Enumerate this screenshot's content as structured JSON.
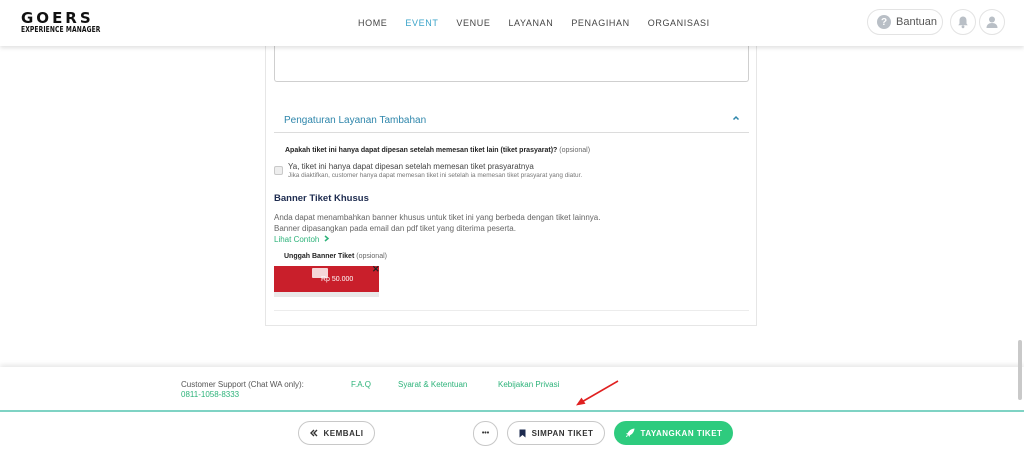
{
  "header": {
    "logo_line1": "GOERS",
    "logo_line2": "EXPERIENCE MANAGER",
    "nav": [
      {
        "label": "HOME",
        "active": false
      },
      {
        "label": "EVENT",
        "active": true
      },
      {
        "label": "VENUE",
        "active": false
      },
      {
        "label": "LAYANAN",
        "active": false
      },
      {
        "label": "PENAGIHAN",
        "active": false
      },
      {
        "label": "ORGANISASI",
        "active": false
      }
    ],
    "help_label": "Bantuan",
    "help_icon": "question-circle-icon",
    "notification_icon": "bell-icon",
    "profile_icon": "user-icon"
  },
  "section": {
    "title": "Pengaturan Layanan Tambahan",
    "question": "Apakah tiket ini hanya dapat dipesan setelah memesan tiket lain (tiket prasyarat)?",
    "question_optional": "(opsional)",
    "checkbox_label": "Ya, tiket ini hanya dapat dipesan setelah memesan tiket prasyaratnya",
    "checkbox_hint": "Jika diaktifkan, customer hanya dapat memesan tiket ini setelah ia memesan tiket prasyarat yang diatur.",
    "checked": false
  },
  "banner": {
    "title": "Banner Tiket Khusus",
    "desc1": "Anda dapat menambahkan banner khusus untuk tiket ini yang berbeda dengan tiket lainnya.",
    "desc2": "Banner dipasangkan pada email dan pdf tiket yang diterima peserta.",
    "example_link": "Lihat Contoh",
    "upload_label": "Unggah Banner Tiket",
    "upload_optional": "(opsional)",
    "thumb_price": "Rp 50.000",
    "remove_symbol": "✕"
  },
  "footer": {
    "support_label": "Customer Support (Chat WA only):",
    "support_phone": "0811-1058-8333",
    "links": [
      "F.A.Q",
      "Syarat & Ketentuan",
      "Kebijakan Privasi"
    ]
  },
  "actions": {
    "back_label": "KEMBALI",
    "more_label": "•••",
    "save_label": "SIMPAN TIKET",
    "publish_label": "TAYANGKAN TIKET"
  },
  "colors": {
    "accent_green": "#2ecb7e",
    "link_blue": "#2e86ab",
    "nav_active": "#3aa3c8",
    "annotation_red": "#e02020"
  }
}
